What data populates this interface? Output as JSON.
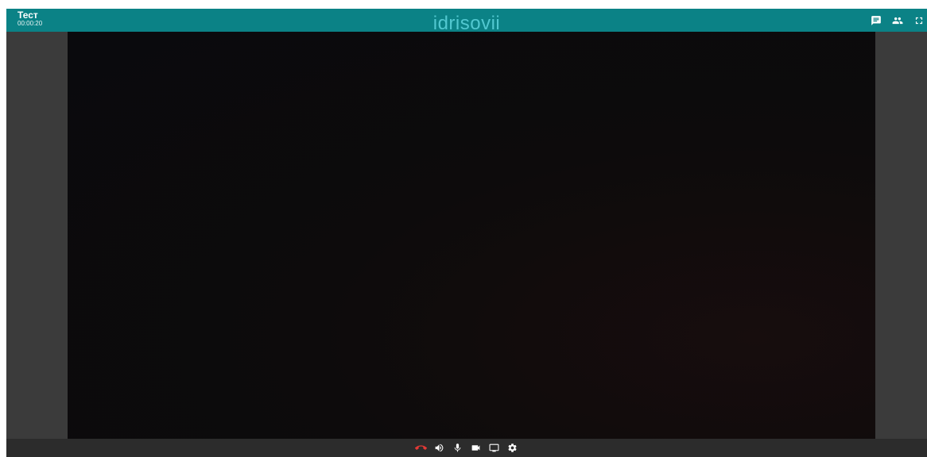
{
  "header": {
    "room_name": "Тест",
    "timer": "00:00:20",
    "participant_name": "idrisovii",
    "actions": [
      {
        "icon": "chat-icon"
      },
      {
        "icon": "participants-icon"
      },
      {
        "icon": "fullscreen-icon"
      }
    ]
  },
  "controls": [
    {
      "icon": "hang-up-icon",
      "color": "#e53935"
    },
    {
      "icon": "speaker-icon"
    },
    {
      "icon": "microphone-icon"
    },
    {
      "icon": "camera-icon"
    },
    {
      "icon": "screen-share-icon"
    },
    {
      "icon": "settings-gear-icon"
    }
  ],
  "colors": {
    "header_background": "#0b8286",
    "participant_name_text": "#52c8d0",
    "side_background": "#3b3b3b",
    "controls_background": "#2c2c2c",
    "hangup": "#e53935"
  }
}
